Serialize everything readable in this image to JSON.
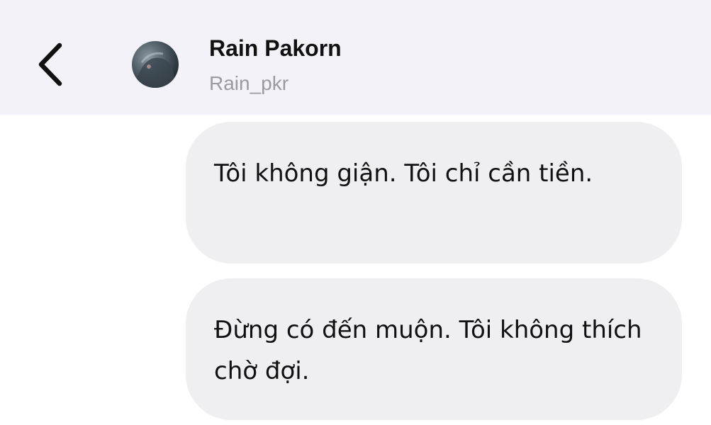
{
  "header": {
    "back_icon": "chevron-left-icon",
    "contact_name": "Rain Pakorn",
    "contact_handle": "Rain_pkr"
  },
  "messages": [
    {
      "text": "Tôi không giận. Tôi chỉ cần tiền."
    },
    {
      "text": "Đừng có đến muộn. Tôi không thích chờ đợi."
    }
  ],
  "colors": {
    "header_bg": "#f3f2f8",
    "bubble_bg": "#efeff1",
    "text": "#111111",
    "handle_text": "#9a9aa0"
  }
}
